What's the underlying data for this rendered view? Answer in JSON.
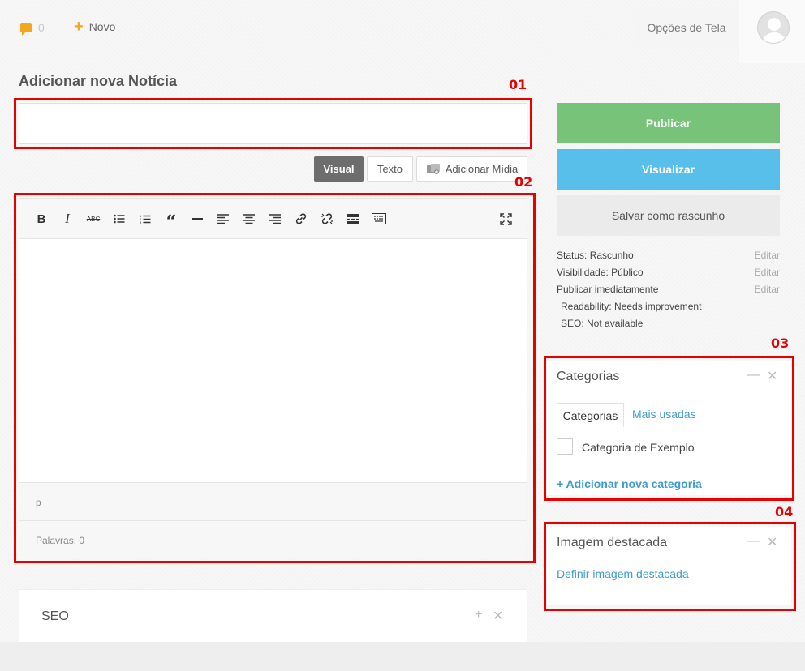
{
  "topbar": {
    "comments_count": "0",
    "new_label": "Novo",
    "screen_options": "Opções de Tela"
  },
  "page_title": "Adicionar nova Notícia",
  "markers": {
    "m1": "01",
    "m2": "02",
    "m3": "03",
    "m4": "04"
  },
  "title_input": {
    "value": "",
    "placeholder": ""
  },
  "editor": {
    "tab_visual": "Visual",
    "tab_text": "Texto",
    "add_media": "Adicionar Mídia",
    "path": "p",
    "word_count": "Palavras: 0",
    "tools": [
      "bold-icon",
      "italic-icon",
      "strikethrough-icon",
      "bullet-list-icon",
      "numbered-list-icon",
      "blockquote-icon",
      "horizontal-rule-icon",
      "align-left-icon",
      "align-center-icon",
      "align-right-icon",
      "link-icon",
      "unlink-icon",
      "read-more-icon",
      "toolbar-toggle-icon",
      "fullscreen-icon"
    ]
  },
  "seo": {
    "title": "SEO"
  },
  "publish_box": {
    "publish": "Publicar",
    "preview": "Visualizar",
    "save_draft": "Salvar como rascunho",
    "status": "Status: Rascunho",
    "visibility": "Visibilidade: Público",
    "schedule": "Publicar imediatamente",
    "edit": "Editar",
    "readability": "Readability: Needs improvement",
    "seo_status": "SEO: Not available"
  },
  "categories": {
    "title": "Categorias",
    "tab_all": "Categorias",
    "tab_popular": "Mais usadas",
    "items": [
      "Categoria de Exemplo"
    ],
    "add_new": "+ Adicionar nova categoria"
  },
  "featured_image": {
    "title": "Imagem destacada",
    "set_link": "Definir imagem destacada"
  },
  "colors": {
    "publish": "#77c37a",
    "preview": "#58bfea",
    "accent": "#f2a71f",
    "link": "#3d9ccf",
    "annotation": "#e60000"
  }
}
